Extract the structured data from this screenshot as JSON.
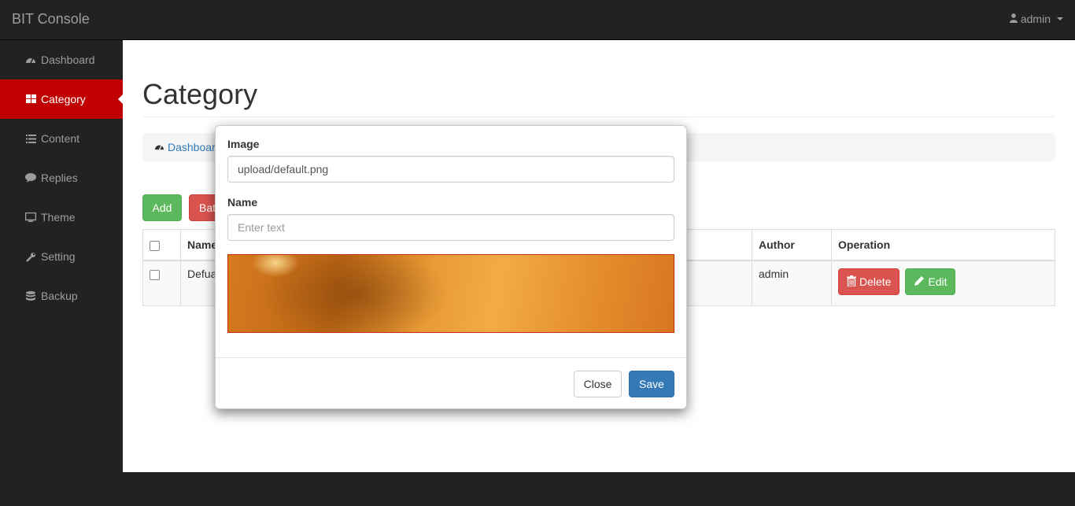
{
  "app": {
    "brand": "BIT Console",
    "user": "admin"
  },
  "sidebar": {
    "items": [
      {
        "label": "Dashboard",
        "icon": "dashboard-icon"
      },
      {
        "label": "Category",
        "icon": "th-large-icon",
        "active": true
      },
      {
        "label": "Content",
        "icon": "list-icon"
      },
      {
        "label": "Replies",
        "icon": "comment-icon"
      },
      {
        "label": "Theme",
        "icon": "monitor-icon"
      },
      {
        "label": "Setting",
        "icon": "wrench-icon"
      },
      {
        "label": "Backup",
        "icon": "database-icon"
      }
    ]
  },
  "page": {
    "title": "Category",
    "breadcrumb": "Dashboard",
    "add_label": "Add",
    "batch_label": "Batch"
  },
  "table": {
    "headers": {
      "name": "Name",
      "author": "Author",
      "operation": "Operation"
    },
    "rows": [
      {
        "name": "Defua",
        "author": "admin",
        "delete_label": "Delete",
        "edit_label": "Edit"
      }
    ]
  },
  "modal": {
    "image_label": "Image",
    "image_value": "upload/default.png",
    "name_label": "Name",
    "name_placeholder": "Enter text",
    "close_label": "Close",
    "save_label": "Save"
  },
  "colors": {
    "accent_red": "#c00000",
    "success": "#5cb85c",
    "danger": "#d9534f",
    "primary": "#337ab7"
  }
}
